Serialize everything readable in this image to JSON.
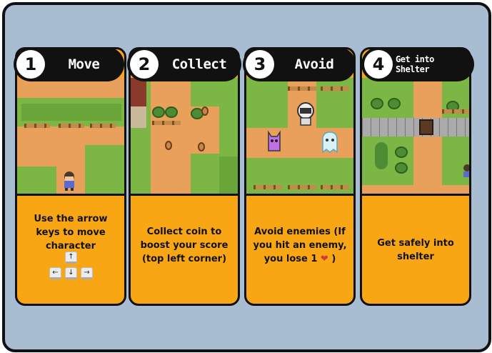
{
  "steps": [
    {
      "number": "1",
      "title": "Move",
      "description": "Use the arrow keys to move character"
    },
    {
      "number": "2",
      "title": "Collect",
      "description": "Collect coin to boost your score (top left corner)"
    },
    {
      "number": "3",
      "title": "Avoid",
      "description": "Avoid enemies (If you hit an enemy, you lose 1"
    },
    {
      "number": "4",
      "title": "Get into Shelter",
      "description": "Get safely into shelter"
    }
  ],
  "avoid_suffix": ")",
  "keys": {
    "up": "↑",
    "left": "←",
    "down": "↓",
    "right": "→"
  },
  "colors": {
    "background": "#a9bdd2",
    "card": "#f9a614",
    "header": "#111111",
    "heart": "#d23a3a"
  },
  "icons": [
    "arrow-keys-icon",
    "heart-icon",
    "coin-icon",
    "player-icon",
    "enemy-icon",
    "shelter-icon"
  ]
}
